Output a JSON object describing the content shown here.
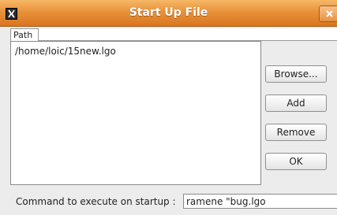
{
  "window": {
    "title": "Start Up File",
    "app_icon": "xlogo-icon",
    "close_icon": "close-icon"
  },
  "tabs": [
    {
      "label": "Path"
    }
  ],
  "file_list": {
    "items": [
      "/home/loic/15new.lgo"
    ]
  },
  "buttons": {
    "browse": "Browse...",
    "add": "Add",
    "remove": "Remove",
    "ok": "OK"
  },
  "command": {
    "label": "Command to execute on startup :",
    "value": "ramene \"bug.lgo"
  },
  "colors": {
    "titlebar_top": "#f6b866",
    "titlebar_bottom": "#d9761f",
    "window_bg": "#ececec"
  }
}
